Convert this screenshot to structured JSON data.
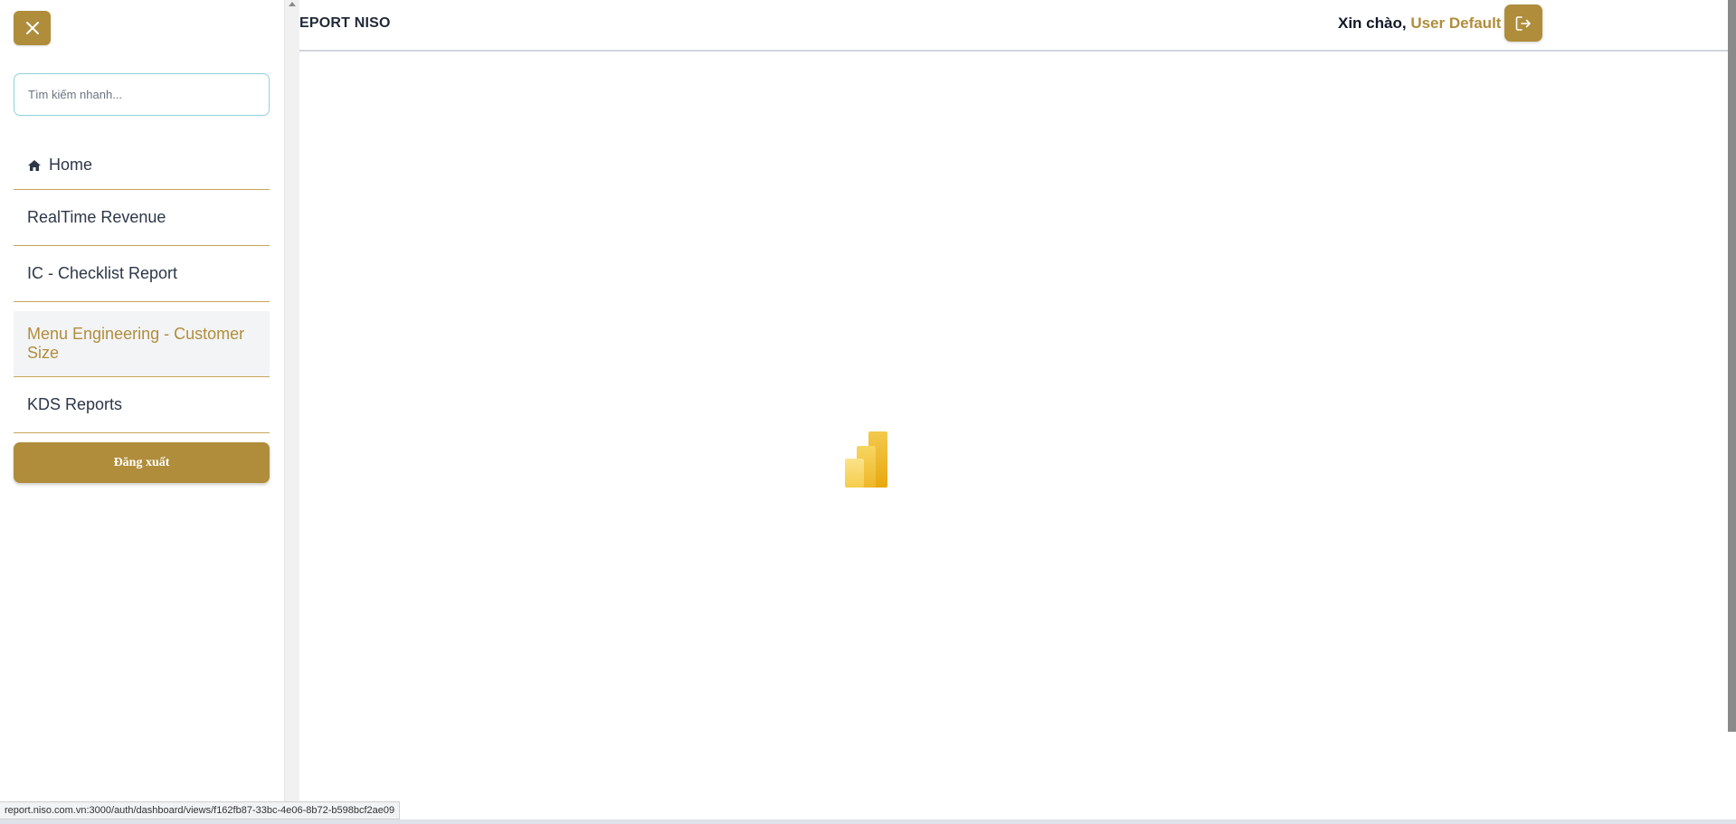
{
  "sidebar": {
    "search": {
      "placeholder": "Tìm kiếm nhanh..."
    },
    "items": [
      {
        "label": "Home",
        "icon": "home-icon",
        "active": false
      },
      {
        "label": "RealTime Revenue",
        "active": false
      },
      {
        "label": "IC - Checklist Report",
        "active": false
      },
      {
        "label": "Menu Engineering - Customer Size",
        "active": true
      },
      {
        "label": "KDS Reports",
        "active": false
      }
    ],
    "logout_label": "Đăng xuất"
  },
  "header": {
    "brand": "EPORT NISO",
    "greeting_prefix": "Xin chào,",
    "username": "User Default"
  },
  "main": {
    "loading_icon": "power-bi-logo-icon"
  },
  "status_bar": {
    "url": "report.niso.com.vn:3000/auth/dashboard/views/f162fb87-33bc-4e06-8b72-b598bcf2ae09"
  },
  "colors": {
    "accent": "#b08d3b",
    "active_bg": "#f3f4f6",
    "search_border": "#8fd0de",
    "divider": "#c9a55a"
  }
}
